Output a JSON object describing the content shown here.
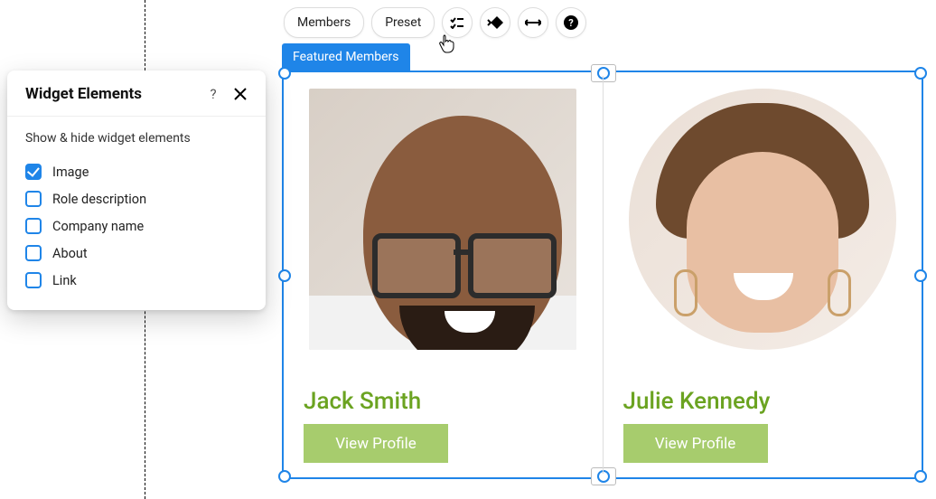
{
  "toolbar": {
    "members_label": "Members",
    "preset_label": "Preset"
  },
  "widget_tab_label": "Featured Members",
  "panel": {
    "title": "Widget Elements",
    "help": "?",
    "subtitle": "Show & hide widget elements",
    "options": {
      "image": {
        "label": "Image",
        "checked": true
      },
      "role": {
        "label": "Role description",
        "checked": false
      },
      "company": {
        "label": "Company name",
        "checked": false
      },
      "about": {
        "label": "About",
        "checked": false
      },
      "link": {
        "label": "Link",
        "checked": false
      }
    }
  },
  "members": {
    "m0": {
      "name": "Jack Smith",
      "cta": "View Profile"
    },
    "m1": {
      "name": "Julie Kennedy",
      "cta": "View Profile"
    }
  }
}
